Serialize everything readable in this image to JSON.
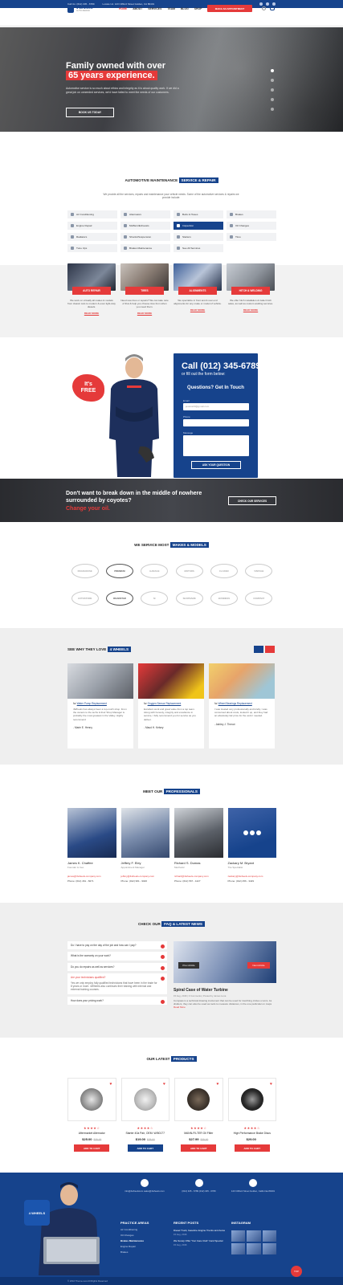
{
  "topbar": {
    "call": "Call Us: (012) 345 - 6789",
    "locate": "Locate Us: 123 Clifford Street Golden, CA 80401"
  },
  "header": {
    "logo_name": "4 WHEELS",
    "logo_tag": "AUTO REPAIR",
    "nav": [
      "HOME",
      "ABOUT",
      "SERVICES",
      "TEAM",
      "BLOG",
      "SHOP"
    ],
    "appointment": "MAKE AN APPOINTMENT",
    "cart_count": "0"
  },
  "hero": {
    "line1": "Family owned with over",
    "line2": "65 years experience.",
    "text": "Automotive service is so much about ethics and integrity as it is about quality work. If we did a great job on unneeded services, we'd have failed to meet the needs of our customers.",
    "button": "BOOK US TODAY"
  },
  "services": {
    "title_a": "AUTOMOTIVE MAINTENANCE",
    "title_b": "SERVICE & REPAIR",
    "subtitle": "We provide all the services, repairs and maintenance your vehicle needs. Some of the automotive services & repairs we provide include:",
    "items": [
      "Air Conditioning",
      "Alternators",
      "Belts & Hoses",
      "Brakes",
      "Engine Repair",
      "Mufflers/Exhausts",
      "Inspection",
      "Oil Changes",
      "Radiators",
      "Shocks/Suspension",
      "Starters",
      "Tires",
      "Tune Ups",
      "Brakes Maintenance",
      "See All Services"
    ],
    "active_index": 6
  },
  "service_cards": [
    {
      "label": "AUTO REPAIR",
      "text": "We work on virtually all makes & models from classic cars to modern & even light-duty diesels.",
      "more": "READ MORE"
    },
    {
      "label": "TIRES",
      "text": "Need new tires or repairs? We can take care of that & help you choose tires from when you need them.",
      "more": "READ MORE"
    },
    {
      "label": "ALIGNMENTS",
      "text": "We specialize in front and & rear end alignments for any make or model of vehicle.",
      "more": "READ MORE"
    },
    {
      "label": "HITCH & WELDING",
      "text": "We offer hitch installation & trailer hitch sales, as well as custom welding services.",
      "more": "READ MORE"
    }
  ],
  "free": {
    "badge_a": "It's",
    "badge_b": "FREE"
  },
  "contact_form": {
    "phone": "Call (012) 345-6789",
    "fill": "or fill out the form below:",
    "heading": "Questions? Get In Touch",
    "email_label": "Email",
    "email_value": "jessica00@gmail.com",
    "phone_label": "Phone",
    "message_label": "Message",
    "button": "ASK YOUR QUESTION"
  },
  "cta": {
    "heading": "Don't want to break down in the middle of nowhere surrounded by coyotes?",
    "accent": "Change your oil.",
    "button": "CHECK OUR SERVICES"
  },
  "makes": {
    "title_a": "WE SERVICE MOST",
    "title_b": "MAKES & MODELS",
    "logos": [
      "ROADHOUSE",
      "PREMIUM",
      "GARAGE",
      "MOTORS",
      "CLASSIC",
      "VINTAGE",
      "AUTOSTORE",
      "ROADSTAR",
      "M",
      "SHOPNAME",
      "BUSINESS",
      "COMPANY"
    ]
  },
  "testimonials": {
    "title_a": "SEE WHY THEY LOVE",
    "title_b": "4 WHEELS",
    "items": [
      {
        "for": "for",
        "service": "Water Pump Replacement",
        "text": "4Wheels has always been a top-notch shop. From the owners to the techs & their Shop Manager is probably the most greatest in the Valley. Highly recommend",
        "name": "- Marie E. Henny"
      },
      {
        "for": "for",
        "service": "Oxygen Sensor Replacement",
        "text": "Excellent work and great value from a top team. Along with honesty, integrity and excellence in service, I fully recommend you for service as you deliver.",
        "name": "- Maud H. Kelsey"
      },
      {
        "for": "for",
        "service": "Wheel Bearings Replacement",
        "text": "I was treated very professionally and kindly. I was concerned about costs, looked it up, and they had an absolutely fair price for the work I needed.",
        "name": "- Ashley J. Thenot"
      }
    ]
  },
  "team": {
    "title_a": "MEET OUR",
    "title_b": "PROFESSIONALS",
    "members": [
      {
        "name": "James K. Chaffee",
        "role": "Founder & Ceo",
        "email": "james@4wheels-company.com",
        "phone": "Phone: (012) 461 - 8271"
      },
      {
        "name": "Jeffery F. Eley",
        "role": "Appointment Manager",
        "email": "jeffery@4wheels-company.com",
        "phone": "Phone: (012) 961 - 9026"
      },
      {
        "name": "Richard S. Dumas",
        "role": "Mechanic",
        "email": "richard@4wheels-company.com",
        "phone": "Phone: (012) 567 - 1227"
      },
      {
        "name": "Zackary M. Bryant",
        "role": "Tire Specialist",
        "email": "zackary@4wheels-company.com",
        "phone": "Phone: (012) 456 - 3429"
      }
    ]
  },
  "faq": {
    "title_a": "CHECK OUR",
    "title_b": "FAQ & LATEST NEWS",
    "items": [
      {
        "q": "Do I have to pay on the day of the job and how can I pay?"
      },
      {
        "q": "What is the warranty on your work?"
      },
      {
        "q": "Do you do repairs as well as services?"
      },
      {
        "q": "Are your technicians qualified?",
        "a": "Yes we only employ fully qualified technicians that have been in the trade for 8 years or more. 4Wheels also continues their training with internal and external training courses."
      },
      {
        "q": "How does your pricing work?"
      }
    ]
  },
  "news": {
    "prev": "Prev Article",
    "next": "Next Article",
    "title": "Spiral Case of Water Turbine",
    "meta": "15 Aug, 2016   |   3 Comments   |   Posted by James Luna",
    "text": "Compass is a technical drawing instrument that can be used for inscribing circles or arcs. As dividers, they can also be used as tools to measure distances, in the one particular on maps",
    "more": "Read More"
  },
  "products": {
    "title_a": "OUR LATEST",
    "title_b": "PRODUCTS",
    "items": [
      {
        "name": "Aftermarket Alternator",
        "price": "$25.00",
        "old": "$35.00",
        "stars": "★★★★☆",
        "button": "ADD TO CART",
        "btn_color": "#e53a3a"
      },
      {
        "name": "Starter 40a Pair, OEM: W/50177",
        "price": "$19.00",
        "old": "$25.00",
        "stars": "★★★★☆",
        "button": "ADD TO CART",
        "btn_color": "#16438c"
      },
      {
        "name": "MANN-FILTER Oil Filter",
        "price": "$27.99",
        "old": "$35.00",
        "stars": "★★★★☆",
        "button": "ADD TO CART",
        "btn_color": "#e53a3a"
      },
      {
        "name": "High Performance Brake Discs",
        "price": "$29.00",
        "old": "",
        "stars": "★★★★☆",
        "button": "ADD TO CART",
        "btn_color": "#e53a3a"
      }
    ]
  },
  "footer": {
    "logo": "4 WHEELS",
    "contacts": [
      {
        "text": "info@4wheelscom\nsales@4wheels.com"
      },
      {
        "text": "(012) 345 - 6789\n(012) 345 - 6780"
      },
      {
        "text": "123 Clifford Street Golden, California 80401"
      }
    ],
    "practice_h": "PRACTICE AREAS",
    "practice": [
      "Air Conditioning",
      "Oil Changes",
      "Brakes Maintenance",
      "Engine Repair",
      "Brakes"
    ],
    "recent_h": "RECENT POSTS",
    "recent": [
      {
        "t": "Diesel Truck, Gasoline Engine Trucks and Autos",
        "d": "15 Aug, 2016"
      },
      {
        "t": "We Surely Offer \"Car Care Club\" Card Special",
        "d": "15 Aug, 2016"
      }
    ],
    "insta_h": "INSTAGRAM",
    "copyright": "© 2016 Theme-next All Rights Reserved",
    "top": "TOP"
  },
  "colors": {
    "brand_blue": "#16438c",
    "accent_red": "#e53a3a"
  }
}
